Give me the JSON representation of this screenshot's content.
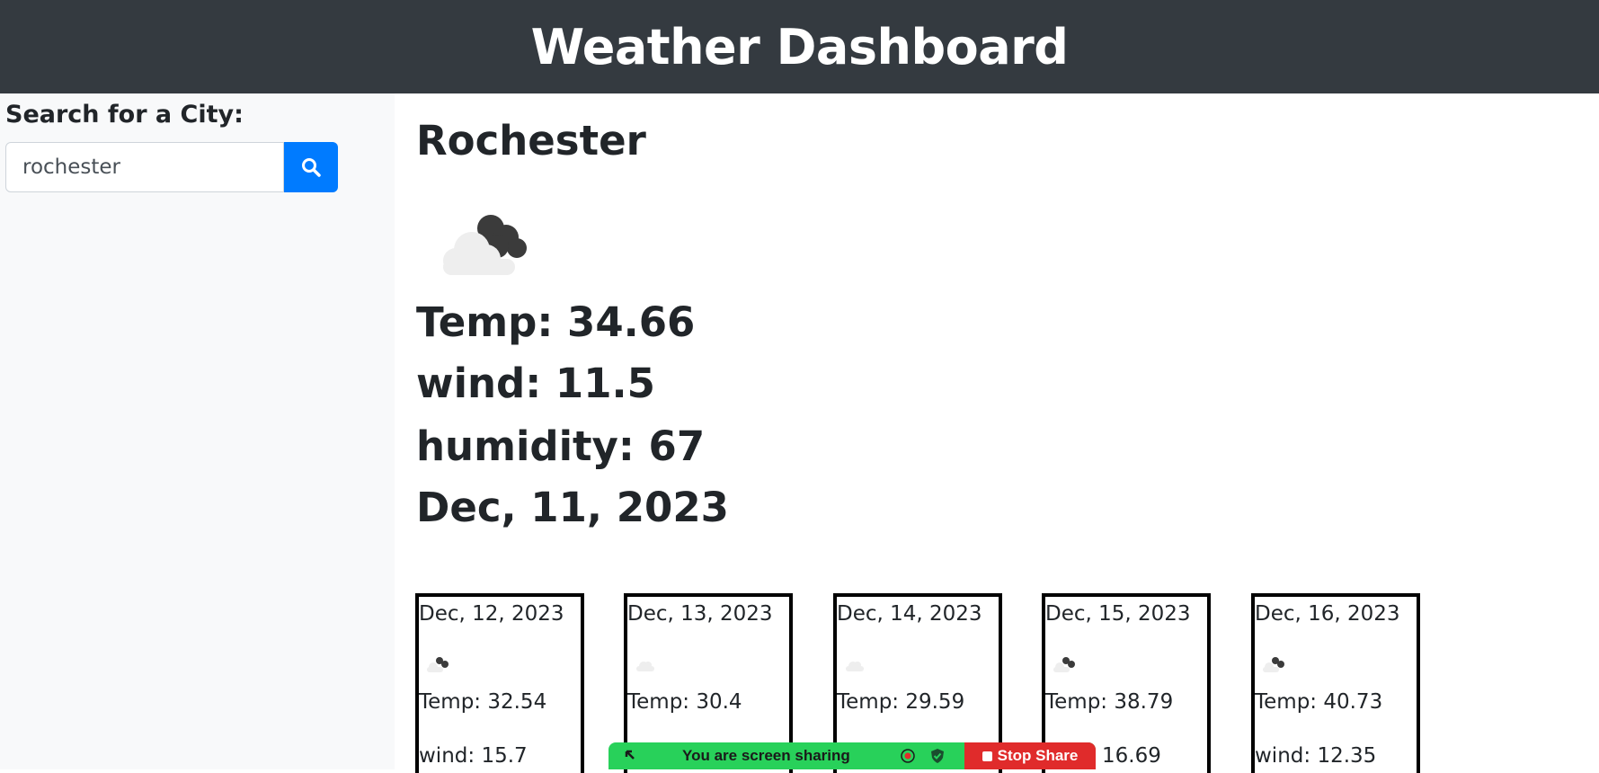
{
  "header": {
    "title": "Weather Dashboard"
  },
  "sidebar": {
    "search_label": "Search for a City:",
    "search_value": "rochester",
    "search_button_icon": "search-icon"
  },
  "current": {
    "city": "Rochester",
    "icon": "broken-clouds-icon",
    "temp": "Temp: 34.66",
    "wind": "wind: 11.5",
    "humidity": "humidity: 67",
    "date": "Dec, 11, 2023"
  },
  "forecast": [
    {
      "date": "Dec, 12, 2023",
      "icon": "broken-clouds-icon",
      "temp": "Temp: 32.54",
      "wind": "wind: 15.7"
    },
    {
      "date": "Dec, 13, 2023",
      "icon": "few-clouds-icon",
      "temp": "Temp: 30.4",
      "wind": ""
    },
    {
      "date": "Dec, 14, 2023",
      "icon": "few-clouds-icon",
      "temp": "Temp: 29.59",
      "wind": ""
    },
    {
      "date": "Dec, 15, 2023",
      "icon": "broken-clouds-icon",
      "temp": "Temp: 38.79",
      "wind": "16.69"
    },
    {
      "date": "Dec, 16, 2023",
      "icon": "broken-clouds-icon",
      "temp": "Temp: 40.73",
      "wind": "wind: 12.35"
    }
  ],
  "share_bar": {
    "text": "You are screen sharing",
    "stop_label": "Stop Share"
  },
  "colors": {
    "header_bg": "#343a40",
    "sidebar_bg": "#f8f9fa",
    "button_blue": "#007bff",
    "share_green": "#28d15a",
    "stop_red": "#e02b2b"
  }
}
